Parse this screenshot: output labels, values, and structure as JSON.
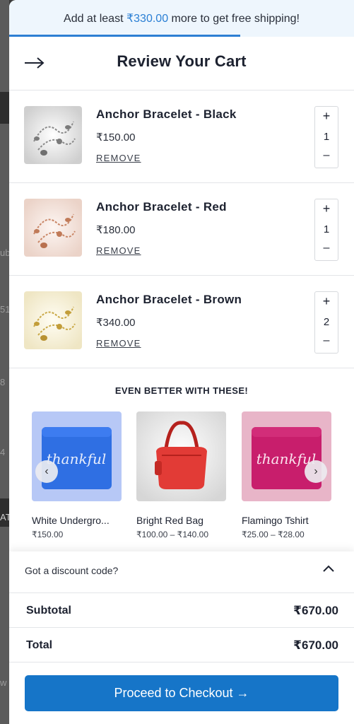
{
  "background_page": {
    "visible_chars": [
      "ub",
      "51",
      "8",
      "4",
      "AT",
      "w"
    ]
  },
  "shipping_bar": {
    "prefix": "Add at least ",
    "amount": "₹330.00",
    "suffix": " more to get free shipping!",
    "progress_percent": 67,
    "accent_color": "#2d7fd3"
  },
  "header": {
    "title": "Review Your Cart",
    "close_icon": "arrow-right-icon"
  },
  "cart_items": [
    {
      "name": "Anchor Bracelet - Black",
      "price": "₹150.00",
      "remove_label": "REMOVE",
      "quantity": "1",
      "plus": "+",
      "minus": "–",
      "image_icon": "bracelet-silver-image"
    },
    {
      "name": "Anchor Bracelet - Red",
      "price": "₹180.00",
      "remove_label": "REMOVE",
      "quantity": "1",
      "plus": "+",
      "minus": "–",
      "image_icon": "bracelet-rose-gold-image"
    },
    {
      "name": "Anchor Bracelet - Brown",
      "price": "₹340.00",
      "remove_label": "REMOVE",
      "quantity": "2",
      "plus": "+",
      "minus": "–",
      "image_icon": "bracelet-gold-image"
    }
  ],
  "upsell": {
    "title": "EVEN BETTER WITH THESE!",
    "prev_icon": "chevron-left-icon",
    "next_icon": "chevron-right-icon",
    "products": [
      {
        "name": "White Undergro...",
        "price": "₹150.00",
        "image_text": "thankful",
        "color": "#2f6fe3"
      },
      {
        "name": "Bright Red Bag",
        "price": "₹100.00 – ₹140.00",
        "color": "#e23b36"
      },
      {
        "name": "Flamingo Tshirt",
        "price": "₹25.00 – ₹28.00",
        "image_text": "thankful",
        "color": "#c81e6c"
      }
    ]
  },
  "discount": {
    "label": "Got a discount code?",
    "icon": "chevron-up-icon"
  },
  "summary": {
    "subtotal_label": "Subtotal",
    "subtotal_value": "₹670.00",
    "total_label": "Total",
    "total_value": "₹670.00"
  },
  "checkout": {
    "label": "Proceed to Checkout →",
    "color": "#1675c8"
  }
}
